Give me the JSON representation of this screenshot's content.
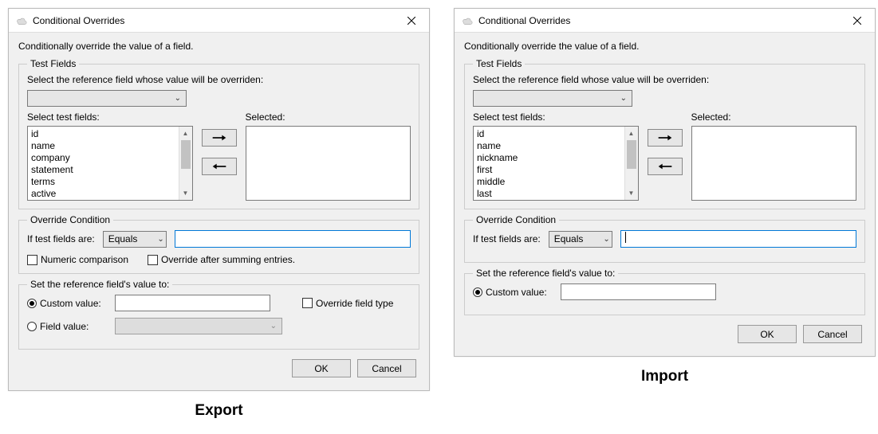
{
  "dialogs": [
    {
      "key": "export",
      "title": "Conditional Overrides",
      "description": "Conditionally override the value of a field.",
      "testFields": {
        "legend": "Test Fields",
        "refLabel": "Select the reference field whose value will be overriden:",
        "availLabel": "Select test fields:",
        "selectedLabel": "Selected:",
        "available": [
          "id",
          "name",
          "company",
          "statement",
          "terms",
          "active"
        ]
      },
      "override": {
        "legend": "Override Condition",
        "ifLabel": "If test fields are:",
        "operator": "Equals",
        "value": "",
        "numericLabel": "Numeric comparison",
        "sumLabel": "Override after summing entries."
      },
      "setValue": {
        "legend": "Set the reference field's value to:",
        "customLabel": "Custom value:",
        "fieldLabel": "Field value:",
        "overrideTypeLabel": "Override field type",
        "showExtras": true
      },
      "buttons": {
        "ok": "OK",
        "cancel": "Cancel"
      },
      "caption": "Export"
    },
    {
      "key": "import",
      "title": "Conditional Overrides",
      "description": "Conditionally override the value of a field.",
      "testFields": {
        "legend": "Test Fields",
        "refLabel": "Select the reference field whose value will be overriden:",
        "availLabel": "Select test fields:",
        "selectedLabel": "Selected:",
        "available": [
          "id",
          "name",
          "nickname",
          "first",
          "middle",
          "last"
        ]
      },
      "override": {
        "legend": "Override Condition",
        "ifLabel": "If test fields are:",
        "operator": "Equals",
        "value": ""
      },
      "setValue": {
        "legend": "Set the reference field's value to:",
        "customLabel": "Custom value:",
        "showExtras": false
      },
      "buttons": {
        "ok": "OK",
        "cancel": "Cancel"
      },
      "caption": "Import"
    }
  ]
}
